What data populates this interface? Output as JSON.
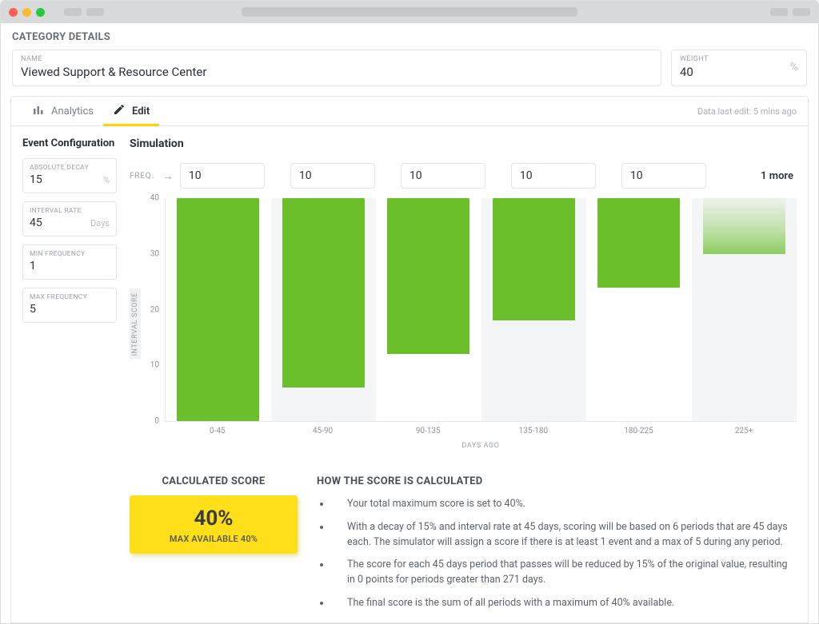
{
  "page_title": "CATEGORY DETAILS",
  "fields": {
    "name_label": "NAME",
    "name_value": "Viewed Support & Resource Center",
    "weight_label": "WEIGHT",
    "weight_value": "40",
    "weight_unit": "%"
  },
  "tabs": {
    "analytics": "Analytics",
    "edit": "Edit",
    "last_edit": "Data last edit: 5 mins ago"
  },
  "sidebar": {
    "title": "Event Configuration",
    "absolute_decay": {
      "label": "ABSOLUTE DECAY",
      "value": "15",
      "unit": "%"
    },
    "interval_rate": {
      "label": "INTERVAL RATE",
      "value": "45",
      "unit": "Days"
    },
    "min_freq": {
      "label": "MIN FREQUENCY",
      "value": "1",
      "unit": ""
    },
    "max_freq": {
      "label": "MAX FREQUENCY",
      "value": "5",
      "unit": ""
    }
  },
  "simulation": {
    "title": "Simulation",
    "freq_label": "FREQ.",
    "inputs": [
      "10",
      "10",
      "10",
      "10",
      "10"
    ],
    "more": "1 more"
  },
  "chart_data": {
    "type": "bar",
    "categories": [
      "0-45",
      "45-90",
      "90-135",
      "135-180",
      "180-225",
      "225+"
    ],
    "values": [
      40,
      34,
      28,
      22,
      16,
      10
    ],
    "faded_last": true,
    "ylabel": "INTERVAL SCORE",
    "xlabel": "DAYS AGO",
    "ylim": [
      0,
      40
    ],
    "y_ticks": [
      0,
      10,
      20,
      30,
      40
    ]
  },
  "score": {
    "head": "CALCULATED SCORE",
    "big": "40%",
    "sub": "MAX AVAILABLE 40%"
  },
  "explain": {
    "head": "HOW THE SCORE IS CALCULATED",
    "bullets": [
      "Your total maximum score is set to 40%.",
      "With a decay of 15% and interval rate at 45 days, scoring will be based on 6 periods that are 45 days each. The simulator will assign a score if there is at least 1 event and a max of 5 during any period.",
      "The score for each 45 days period that passes will be reduced by 15% of the original value, resulting in 0 points for periods greater than 271 days.",
      "The final score is the sum of all periods with a maximum of 40% available."
    ]
  }
}
